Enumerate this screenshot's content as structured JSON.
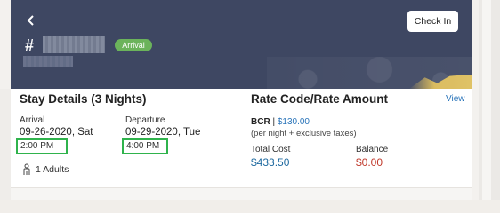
{
  "header": {
    "back_icon": "chevron-left-icon",
    "hash": "#",
    "status_badge": "Arrival",
    "checkin_label": "Check In",
    "colors": {
      "header_bg": "#3e4762",
      "badge_bg": "#6bb35b"
    }
  },
  "stay": {
    "title": "Stay Details (3 Nights)",
    "arrival_label": "Arrival",
    "arrival_date": "09-26-2020, Sat",
    "arrival_time": "2:00 PM",
    "departure_label": "Departure",
    "departure_date": "09-29-2020, Tue",
    "departure_time": "4:00 PM",
    "guests": "1 Adults",
    "guests_icon": "person-icon"
  },
  "rate": {
    "title": "Rate Code/Rate Amount",
    "view_label": "View",
    "code": "BCR",
    "separator": " | ",
    "amount": "$130.00",
    "sub": "(per night + exclusive taxes)",
    "total_cost_label": "Total Cost",
    "total_cost": "$433.50",
    "balance_label": "Balance",
    "balance": "$0.00",
    "colors": {
      "link": "#2873b9",
      "total": "#1f6aa0",
      "balance": "#c0392b"
    }
  }
}
